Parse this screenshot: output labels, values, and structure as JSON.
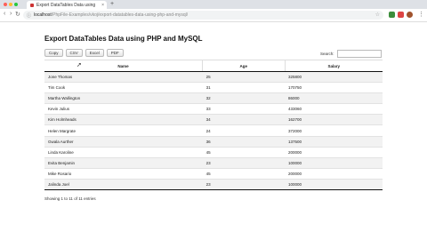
{
  "browser": {
    "tab_title": "Export DataTables Data using",
    "tab_close": "×",
    "new_tab": "+",
    "nav": {
      "back": "‹",
      "forward": "›",
      "reload": "↻"
    },
    "url_host": "localhost",
    "url_path": "/PhpFile-Examples/vkoj/export-datatables-data-using-php-and-mysql/",
    "menu": "⋮"
  },
  "page": {
    "title": "Export DataTables Data using PHP and MySQL",
    "buttons": {
      "copy": "Copy",
      "csv": "CSV",
      "excel": "Excel",
      "pdf": "PDF"
    },
    "search_label": "Search:",
    "search_value": "",
    "columns": {
      "name": "Name",
      "age": "Age",
      "salary": "Salary"
    },
    "rows": [
      {
        "name": "Jone Thomas",
        "age": "25",
        "salary": "325800"
      },
      {
        "name": "Tim Cook",
        "age": "31",
        "salary": "170750"
      },
      {
        "name": "Martha Wallington",
        "age": "32",
        "salary": "86000"
      },
      {
        "name": "Kevin Julius",
        "age": "33",
        "salary": "433060"
      },
      {
        "name": "Kim Holmheads",
        "age": "34",
        "salary": "162700"
      },
      {
        "name": "Helen Margrate",
        "age": "24",
        "salary": "372000"
      },
      {
        "name": "Gwala Aurther",
        "age": "36",
        "salary": "137500"
      },
      {
        "name": "Linda Karoline",
        "age": "45",
        "salary": "200000"
      },
      {
        "name": "Evita Benjamin",
        "age": "23",
        "salary": "100000"
      },
      {
        "name": "Mike Rosario",
        "age": "45",
        "salary": "200000"
      },
      {
        "name": "Jalinda Joel",
        "age": "23",
        "salary": "100000"
      }
    ],
    "info": "Showing 1 to 11 of 11 entries"
  },
  "colors": {
    "close": "#ff5f57",
    "minimize": "#febc2e",
    "maximize": "#28c840",
    "ext_green": "#3c8d3c",
    "ext_red": "#d44",
    "avatar": "#a0522d"
  }
}
